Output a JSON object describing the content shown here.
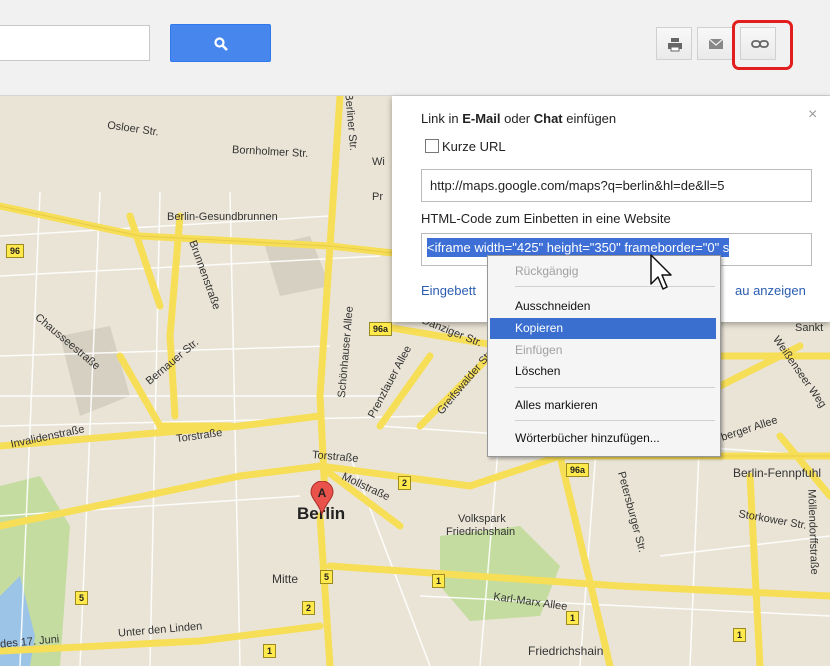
{
  "toolbar": {
    "search_value": "",
    "search_button_icon": "search-icon",
    "print_icon": "print-icon",
    "email_icon": "email-icon",
    "link_icon": "link-icon"
  },
  "map": {
    "labels": {
      "osloer": "Osloer Str.",
      "bornholmer": "Bornholmer Str.",
      "gesundbrunnen": "Berlin-Gesundbrunnen",
      "brunnen": "Brunnenstraße",
      "bernauer": "Bernauer Str.",
      "chaussee": "Chausseestraße",
      "invaliden": "Invalidenstraße",
      "torstr": "Torstraße",
      "torstr2": "Torstraße",
      "schoenhauser": "Schönhauser Allee",
      "prenzlauer": "Prenzlauer Allee",
      "greifswalder": "Greifswalder Str.",
      "danziger": "Danziger Str.",
      "mollstr": "Mollstraße",
      "berlin": "Berlin",
      "mitte": "Mitte",
      "unter_den_linden": "Unter den Linden",
      "juni": "des 17. Juni",
      "volkspark": "Volkspark",
      "friedrichshain_park": "Friedrichshain",
      "friedrichshain": "Friedrichshain",
      "karl_marx": "Karl-Marx Allee",
      "petersburger": "Petersburger Str.",
      "fennpfuhl": "Berlin-Fennpfuhl",
      "storkower": "Storkower Str.",
      "moellendorf": "Möllendorffstraße",
      "weissenseer": "Weißenseer Weg",
      "berger_allee": "berger Allee",
      "sankt": "Sankt",
      "wi": "Wi",
      "pr": "Pr",
      "berliner_str": "Berliner Str."
    },
    "shields": [
      "96",
      "96a",
      "96a",
      "2",
      "5",
      "5",
      "2",
      "1",
      "1",
      "1",
      "1"
    ],
    "marker_letter": "A"
  },
  "share_panel": {
    "title_prefix": "Link in ",
    "title_email": "E-Mail",
    "title_middle": " oder ",
    "title_chat": "Chat",
    "title_suffix": " einfügen",
    "close": "×",
    "short_url_label": "Kurze URL",
    "url_value": "http://maps.google.com/maps?q=berlin&hl=de&ll=5",
    "embed_label": "HTML-Code zum Einbetten in eine Website",
    "embed_value": "<iframe width=\"425\" height=\"350\" frameborder=\"0\" s",
    "link_left": "Eingebett",
    "link_right": "au anzeigen"
  },
  "context_menu": {
    "undo": "Rückgängig",
    "cut": "Ausschneiden",
    "copy": "Kopieren",
    "paste": "Einfügen",
    "delete": "Löschen",
    "select_all": "Alles markieren",
    "add_dictionaries": "Wörterbücher hinzufügen..."
  },
  "colors": {
    "accent": "#4787ed",
    "highlight": "#e21d1d",
    "selection": "#3a6fd0",
    "road": "#f7de57",
    "map_bg": "#eae4d6"
  }
}
